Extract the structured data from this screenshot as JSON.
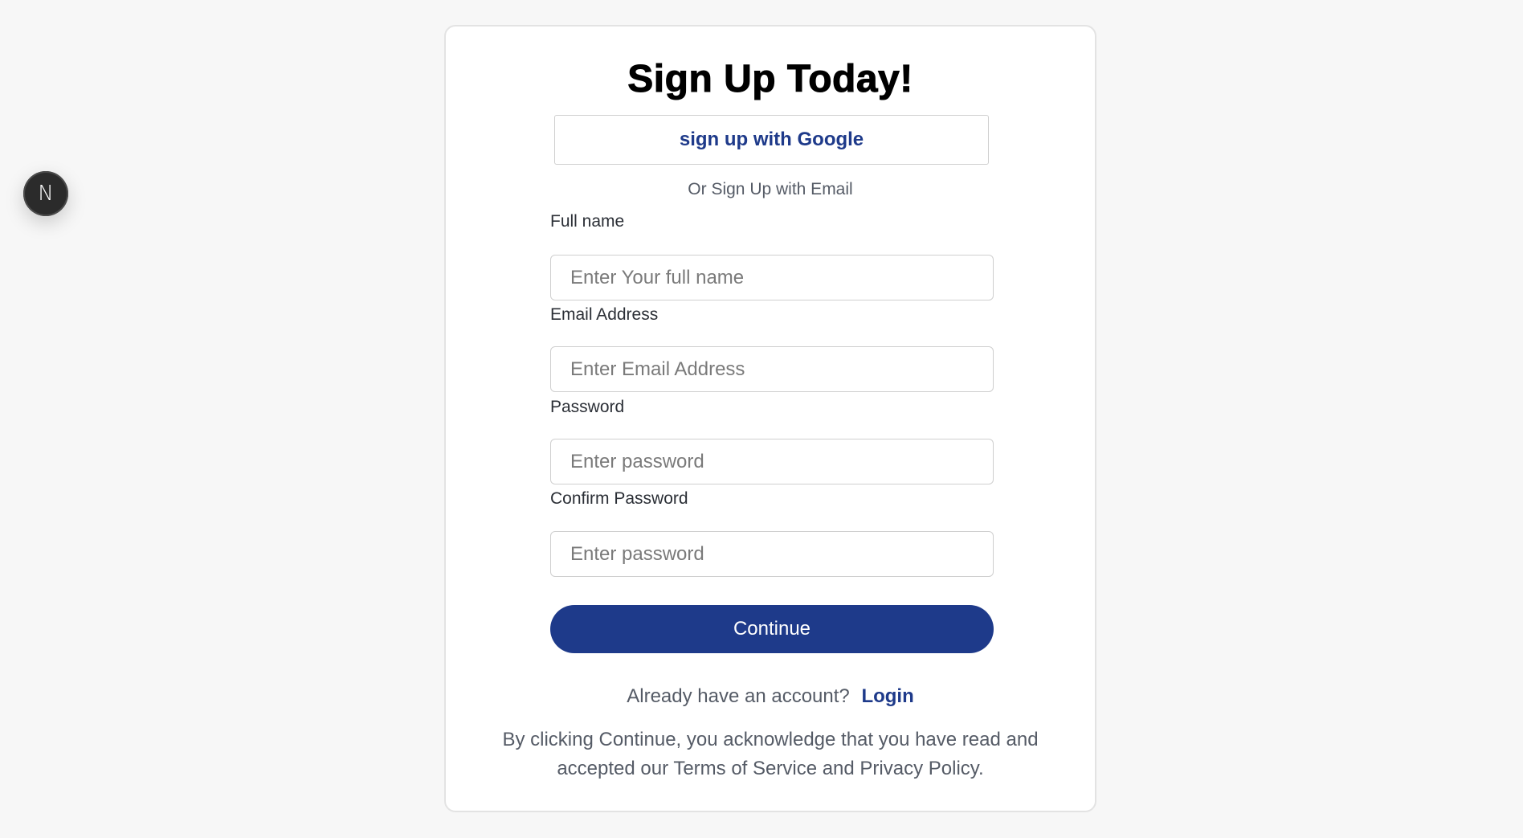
{
  "badge": {
    "letter": "N",
    "icon": "nextjs-logo-icon"
  },
  "form": {
    "title": "Sign Up Today!",
    "google_button": "sign up with Google",
    "divider": "Or Sign Up with Email",
    "fields": [
      {
        "label": "Full name",
        "placeholder": "Enter Your full name",
        "value": ""
      },
      {
        "label": "Email Address",
        "placeholder": "Enter Email Address",
        "value": ""
      },
      {
        "label": "Password",
        "placeholder": "Enter password",
        "value": ""
      },
      {
        "label": "Confirm Password",
        "placeholder": "Enter password",
        "value": ""
      }
    ],
    "continue_button": "Continue",
    "login_prompt": "Already have an account?",
    "login_link": "Login",
    "terms": "By clicking Continue, you acknowledge that you have read and accepted our Terms of Service and Privacy Policy."
  },
  "colors": {
    "accent": "#1e3a8a",
    "background": "#f7f7f7",
    "card": "#ffffff"
  }
}
